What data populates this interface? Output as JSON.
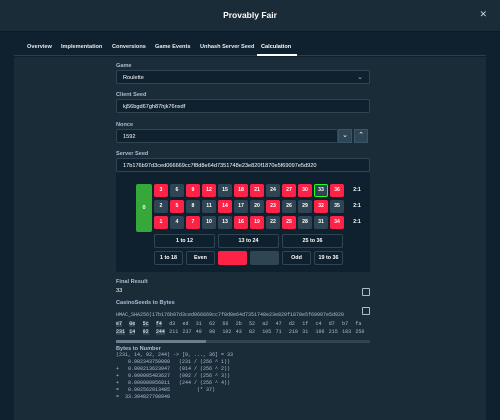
{
  "window": {
    "title": "Provably Fair",
    "close_glyph": "✕"
  },
  "tabs": [
    {
      "label": "Overview",
      "active": false
    },
    {
      "label": "Implementation",
      "active": false
    },
    {
      "label": "Conversions",
      "active": false
    },
    {
      "label": "Game Events",
      "active": false
    },
    {
      "label": "Unhash Server Seed",
      "active": false
    },
    {
      "label": "Calculation",
      "active": true
    }
  ],
  "form": {
    "game_label": "Game",
    "game_value": "Roulette",
    "client_seed_label": "Client Seed",
    "client_seed_value": "kj56bgd67gh87hjk76nxdf",
    "nonce_label": "Nonce",
    "nonce_value": "1592",
    "server_seed_label": "Server Seed",
    "server_seed_value": "17b176b97d3ced066669cc7f8d8e64d7351748e23e820f1870e5f69097e5d920"
  },
  "roulette": {
    "zero": "0",
    "rows": [
      [
        {
          "n": "3",
          "c": "red"
        },
        {
          "n": "6",
          "c": "black"
        },
        {
          "n": "9",
          "c": "red"
        },
        {
          "n": "12",
          "c": "red"
        },
        {
          "n": "15",
          "c": "black"
        },
        {
          "n": "18",
          "c": "red"
        },
        {
          "n": "21",
          "c": "red"
        },
        {
          "n": "24",
          "c": "black"
        },
        {
          "n": "27",
          "c": "red"
        },
        {
          "n": "30",
          "c": "red"
        },
        {
          "n": "33",
          "c": "black",
          "hit": true
        },
        {
          "n": "36",
          "c": "red"
        }
      ],
      [
        {
          "n": "2",
          "c": "black"
        },
        {
          "n": "5",
          "c": "red"
        },
        {
          "n": "8",
          "c": "black"
        },
        {
          "n": "11",
          "c": "black"
        },
        {
          "n": "14",
          "c": "red"
        },
        {
          "n": "17",
          "c": "black"
        },
        {
          "n": "20",
          "c": "black"
        },
        {
          "n": "23",
          "c": "red"
        },
        {
          "n": "26",
          "c": "black"
        },
        {
          "n": "29",
          "c": "black"
        },
        {
          "n": "32",
          "c": "red"
        },
        {
          "n": "35",
          "c": "black"
        }
      ],
      [
        {
          "n": "1",
          "c": "red"
        },
        {
          "n": "4",
          "c": "black"
        },
        {
          "n": "7",
          "c": "red"
        },
        {
          "n": "10",
          "c": "black"
        },
        {
          "n": "13",
          "c": "black"
        },
        {
          "n": "16",
          "c": "red"
        },
        {
          "n": "19",
          "c": "red"
        },
        {
          "n": "22",
          "c": "black"
        },
        {
          "n": "25",
          "c": "red"
        },
        {
          "n": "28",
          "c": "black"
        },
        {
          "n": "31",
          "c": "black"
        },
        {
          "n": "34",
          "c": "red"
        }
      ]
    ],
    "columns": [
      "2:1",
      "2:1",
      "2:1"
    ],
    "dozens": [
      "1 to 12",
      "13 to 24",
      "25 to 36"
    ],
    "outside": [
      "1 to 18",
      "Even",
      "",
      "",
      "Odd",
      "19 to 36"
    ]
  },
  "final_result": {
    "label": "Final Result",
    "value": "33"
  },
  "casino_seeds": {
    "label": "CasinoSeeds to Bytes",
    "hmac_line": "HMAC_SHA256(17b176b97d3ced066669cc7f8d8e64d7351748e23e820f1870e5f69097e5d920",
    "hex_row": [
      "e7",
      "0e",
      "5c",
      "f4",
      "d3",
      "ed",
      "31",
      "62",
      "66",
      "2b",
      "52",
      "a2",
      "47",
      "d2",
      "1f",
      "c4",
      "d7",
      "b7",
      "fa"
    ],
    "dec_row": [
      "231",
      "14",
      "92",
      "244",
      "211",
      "237",
      "49",
      "98",
      "102",
      "43",
      "82",
      "105",
      "71",
      "210",
      "31",
      "196",
      "215",
      "183",
      "250"
    ]
  },
  "bytes_to_number": {
    "label": "Bytes to Number",
    "lines": [
      "(231, 14, 92, 244) -> [0, ..., 36] = 33",
      "    0.902343750000   (231 / (256 ^ 1))",
      "+   0.000213623047   (014 / (256 ^ 2))",
      "+   0.000005483627   (092 / (256 ^ 3))",
      "+   0.000000056811   (244 / (256 ^ 4))",
      "=   0.902562913485         (* 37)",
      "=  33.394827798940"
    ]
  },
  "colors": {
    "background": "#0f212e",
    "panel": "#1a2c38",
    "red": "#fe2247",
    "green": "#36a83a",
    "black": "#2f4553"
  }
}
